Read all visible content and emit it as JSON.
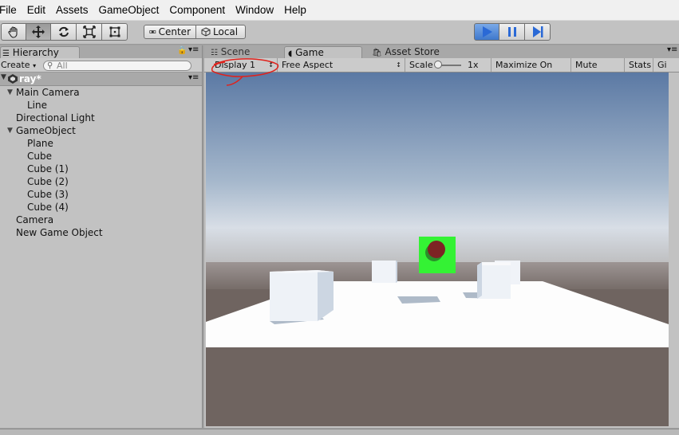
{
  "menu": [
    "File",
    "Edit",
    "Assets",
    "GameObject",
    "Component",
    "Window",
    "Help"
  ],
  "toolbar": {
    "center_label": "Center",
    "local_label": "Local",
    "tools": [
      "hand-tool-icon",
      "move-tool-icon",
      "rotate-tool-icon",
      "scale-tool-icon",
      "rect-tool-icon"
    ]
  },
  "hierarchy": {
    "tab_label": "Hierarchy",
    "create_label": "Create",
    "search_placeholder": "All",
    "scene_name": "ray*",
    "items": [
      {
        "label": "Main Camera",
        "indent": 1,
        "expanded": true
      },
      {
        "label": "Line",
        "indent": 2
      },
      {
        "label": "Directional Light",
        "indent": 1
      },
      {
        "label": "GameObject",
        "indent": 1,
        "expanded": true
      },
      {
        "label": "Plane",
        "indent": 2
      },
      {
        "label": "Cube",
        "indent": 2
      },
      {
        "label": "Cube (1)",
        "indent": 2
      },
      {
        "label": "Cube (2)",
        "indent": 2
      },
      {
        "label": "Cube (3)",
        "indent": 2
      },
      {
        "label": "Cube (4)",
        "indent": 2
      },
      {
        "label": "Camera",
        "indent": 1
      },
      {
        "label": "New Game Object",
        "indent": 1
      }
    ]
  },
  "game": {
    "tabs": [
      "Scene",
      "Game",
      "Asset Store"
    ],
    "display_label": "Display 1",
    "aspect_label": "Free Aspect",
    "scale_label": "Scale",
    "scale_value": "1x",
    "maximize_label": "Maximize On Play",
    "mute_label": "Mute Audio",
    "stats_label": "Stats",
    "gizmos_label": "Gi"
  },
  "colors": {
    "sky_top": "#5a78a3",
    "sky_bottom": "#c8d4e0",
    "ground": "#6f6460",
    "plane": "#fdfdfd",
    "target": "#34f234",
    "ball": "#7d2424",
    "annotation": "#e0211b",
    "play_active": "#4a8adf"
  }
}
